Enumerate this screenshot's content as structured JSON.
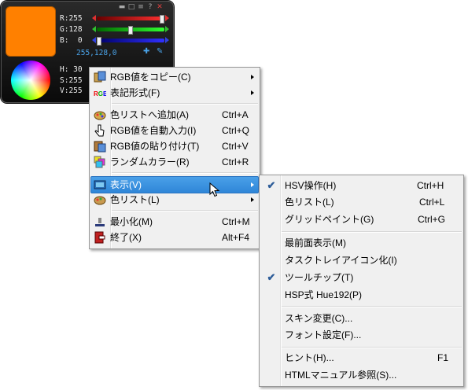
{
  "widget": {
    "swatch_color": "#ff8000",
    "rgb": {
      "r": "R:255",
      "g": "G:128",
      "b": "B:  0"
    },
    "hex": "255,128,0",
    "hsv": {
      "h": "H: 30",
      "s": "S:255",
      "v": "V:255"
    },
    "slider_levels": {
      "r": 1.0,
      "g": 0.5,
      "b": 0.0
    }
  },
  "main_menu": {
    "items": [
      {
        "icon": "copy-rgb-icon",
        "label": "RGB値をコピー(C)",
        "submenu": true
      },
      {
        "icon": "rgb-format-icon",
        "label": "表記形式(F)",
        "submenu": true
      },
      {
        "icon": "add-to-list-icon",
        "label": "色リストへ追加(A)",
        "shortcut": "Ctrl+A"
      },
      {
        "icon": "auto-input-icon",
        "label": "RGB値を自動入力(I)",
        "shortcut": "Ctrl+Q"
      },
      {
        "icon": "paste-icon",
        "label": "RGB値の貼り付け(T)",
        "shortcut": "Ctrl+V"
      },
      {
        "icon": "random-color-icon",
        "label": "ランダムカラー(R)",
        "shortcut": "Ctrl+R"
      },
      {
        "icon": "display-icon",
        "label": "表示(V)",
        "submenu": true,
        "highlighted": true
      },
      {
        "icon": "color-list-icon",
        "label": "色リスト(L)",
        "submenu": true
      },
      {
        "icon": "minimize-icon",
        "label": "最小化(M)",
        "shortcut": "Ctrl+M"
      },
      {
        "icon": "exit-icon",
        "label": "終了(X)",
        "shortcut": "Alt+F4"
      }
    ]
  },
  "sub_menu": {
    "items": [
      {
        "label": "HSV操作(H)",
        "shortcut": "Ctrl+H",
        "checked": true
      },
      {
        "label": "色リスト(L)",
        "shortcut": "Ctrl+L"
      },
      {
        "label": "グリッドペイント(G)",
        "shortcut": "Ctrl+G"
      },
      {
        "label": "最前面表示(M)"
      },
      {
        "label": "タスクトレイアイコン化(I)"
      },
      {
        "label": "ツールチップ(T)",
        "checked": true
      },
      {
        "label": "HSP式 Hue192(P)"
      },
      {
        "label": "スキン変更(C)..."
      },
      {
        "label": "フォント設定(F)..."
      },
      {
        "label": "ヒント(H)...",
        "shortcut": "F1"
      },
      {
        "label": "HTMLマニュアル参照(S)..."
      }
    ]
  },
  "colors": {
    "highlight": "#3a8ee0",
    "menu_bg": "#f0f0f0",
    "accent": "#4aa3e8"
  }
}
